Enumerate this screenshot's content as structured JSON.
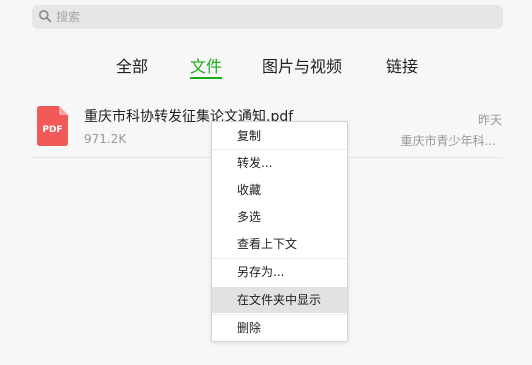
{
  "search": {
    "placeholder": "搜索",
    "icon": "search-icon"
  },
  "tabs": [
    {
      "label": "全部",
      "active": false
    },
    {
      "label": "文件",
      "active": true
    },
    {
      "label": "图片与视频",
      "active": false
    },
    {
      "label": "链接",
      "active": false
    }
  ],
  "file": {
    "icon": "pdf-file-icon",
    "icon_label": "PDF",
    "name": "重庆市科协转发征集论文通知.pdf",
    "size": "971.2K",
    "date": "昨天",
    "sender": "重庆市青少年科..."
  },
  "context_menu": {
    "items": [
      {
        "label": "复制",
        "highlighted": false
      },
      {
        "label": "转发...",
        "highlighted": false
      },
      {
        "label": "收藏",
        "highlighted": false
      },
      {
        "label": "多选",
        "highlighted": false
      },
      {
        "label": "查看上下文",
        "highlighted": false
      },
      {
        "label": "另存为...",
        "highlighted": false
      },
      {
        "label": "在文件夹中显示",
        "highlighted": true
      },
      {
        "label": "删除",
        "highlighted": false
      }
    ]
  },
  "colors": {
    "accent": "#1aad19",
    "pdf_red": "#f25a5a",
    "background": "#f7f7f7"
  }
}
